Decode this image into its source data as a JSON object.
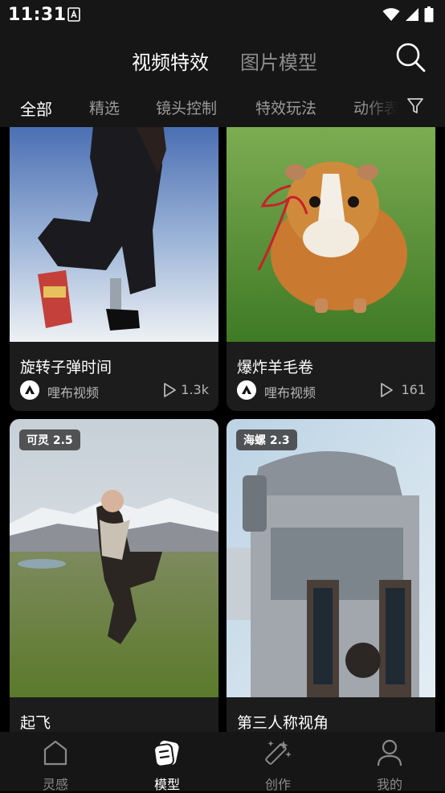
{
  "status_bar": {
    "time": "11:31"
  },
  "header": {
    "tabs": [
      {
        "label": "视频特效",
        "active": true
      },
      {
        "label": "图片模型",
        "active": false
      }
    ]
  },
  "sub_tabs": [
    {
      "label": "全部",
      "active": true
    },
    {
      "label": "精选"
    },
    {
      "label": "镜头控制"
    },
    {
      "label": "特效玩法"
    },
    {
      "label": "动作表"
    }
  ],
  "cards": [
    {
      "title": "旋转子弹时间",
      "author": "哩布视频",
      "views": "1.3k",
      "badge": ""
    },
    {
      "title": "爆炸羊毛卷",
      "author": "哩布视频",
      "views": "161",
      "badge": ""
    },
    {
      "title": "起飞",
      "author": "",
      "views": "",
      "badge": "可灵 2.5"
    },
    {
      "title": "第三人称视角",
      "author": "",
      "views": "",
      "badge": "海螺 2.3"
    }
  ],
  "bottom_nav": [
    {
      "label": "灵感",
      "icon": "home-icon",
      "active": false
    },
    {
      "label": "模型",
      "icon": "model-icon",
      "active": true
    },
    {
      "label": "创作",
      "icon": "magic-wand-icon",
      "active": false
    },
    {
      "label": "我的",
      "icon": "profile-icon",
      "active": false
    }
  ],
  "colors": {
    "background": "#000000",
    "bar": "#161616",
    "card": "#1c1c1c",
    "inactive_text": "#8c8c8c"
  }
}
